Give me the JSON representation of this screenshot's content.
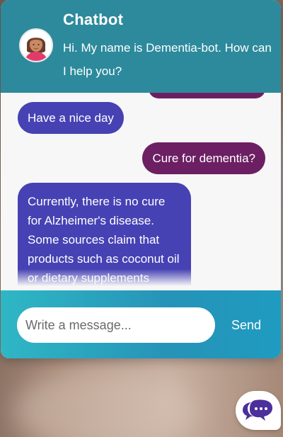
{
  "header": {
    "title": "Chatbot",
    "subtitle": "Hi. My name is Dementia-bot. How can I help you?"
  },
  "messages": [
    {
      "from": "bot",
      "text": "Have a nice day"
    },
    {
      "from": "user",
      "text": "Cure for dementia?"
    },
    {
      "from": "bot",
      "text": "Currently, there is no cure for Alzheimer's disease. Some sources claim that products such as coconut oil or dietary supplements"
    }
  ],
  "composer": {
    "placeholder": "Write a message...",
    "send_label": "Send"
  },
  "colors": {
    "header": "#2d8a9c",
    "bot_bubble": "#4642b4",
    "user_bubble": "#6c1f63",
    "footer_start": "#2fb7c5",
    "footer_end": "#1f9bc0"
  },
  "icons": {
    "avatar": "avatar-icon",
    "launcher": "chat-bubbles-icon"
  }
}
